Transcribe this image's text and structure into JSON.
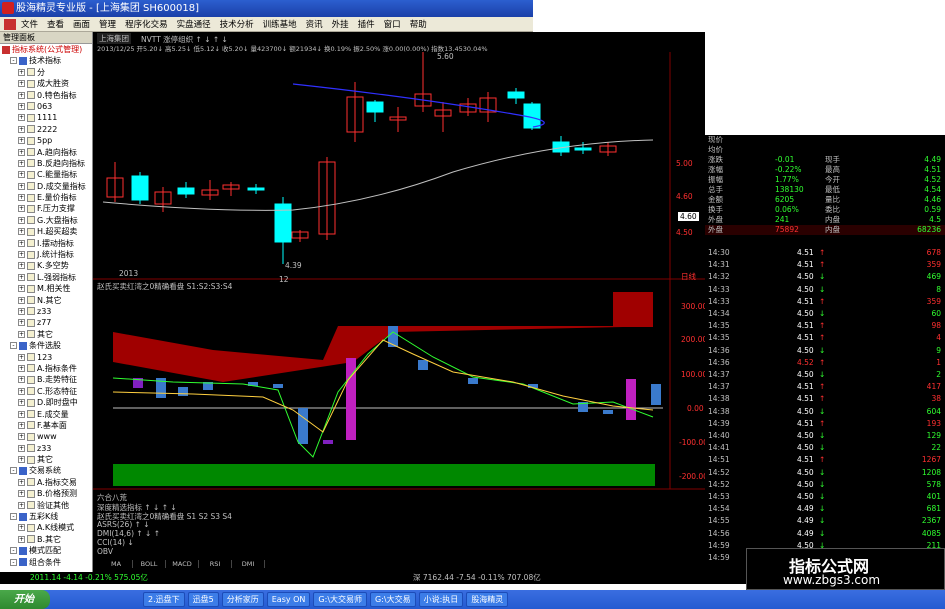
{
  "window": {
    "title": "股海精灵专业版 - [上海集团 SH600018]"
  },
  "menu": [
    "文件",
    "查看",
    "画面",
    "管理",
    "程序化交易",
    "实盘通径",
    "技术分析",
    "训练基地",
    "资讯",
    "外挂",
    "插件",
    "窗口",
    "帮助"
  ],
  "panel": {
    "header": "管理面板",
    "items": [
      {
        "indent": 0,
        "type": "head",
        "label": "指标系统(公式管理)"
      },
      {
        "indent": 1,
        "type": "box",
        "label": "技术指标"
      },
      {
        "indent": 2,
        "type": "leaf",
        "label": "分"
      },
      {
        "indent": 2,
        "type": "leaf",
        "label": "成大胜资"
      },
      {
        "indent": 2,
        "type": "leaf",
        "label": "0.特色指标"
      },
      {
        "indent": 2,
        "type": "leaf",
        "label": "063"
      },
      {
        "indent": 2,
        "type": "leaf",
        "label": "1111"
      },
      {
        "indent": 2,
        "type": "leaf",
        "label": "2222"
      },
      {
        "indent": 2,
        "type": "leaf",
        "label": "5pp"
      },
      {
        "indent": 2,
        "type": "leaf",
        "label": "A.趋向指标"
      },
      {
        "indent": 2,
        "type": "leaf",
        "label": "B.反趋向指标"
      },
      {
        "indent": 2,
        "type": "leaf",
        "label": "C.能量指标"
      },
      {
        "indent": 2,
        "type": "leaf",
        "label": "D.成交量指标"
      },
      {
        "indent": 2,
        "type": "leaf",
        "label": "E.量价指标"
      },
      {
        "indent": 2,
        "type": "leaf",
        "label": "F.压力支撑"
      },
      {
        "indent": 2,
        "type": "leaf",
        "label": "G.大盘指标"
      },
      {
        "indent": 2,
        "type": "leaf",
        "label": "H.超买超卖"
      },
      {
        "indent": 2,
        "type": "leaf",
        "label": "I.摆动指标"
      },
      {
        "indent": 2,
        "type": "leaf",
        "label": "J.统计指标"
      },
      {
        "indent": 2,
        "type": "leaf",
        "label": "K.多空势"
      },
      {
        "indent": 2,
        "type": "leaf",
        "label": "L.强弱指标"
      },
      {
        "indent": 2,
        "type": "leaf",
        "label": "M.相关性"
      },
      {
        "indent": 2,
        "type": "leaf",
        "label": "N.其它"
      },
      {
        "indent": 2,
        "type": "leaf",
        "label": "z33"
      },
      {
        "indent": 2,
        "type": "leaf",
        "label": "z77"
      },
      {
        "indent": 2,
        "type": "leaf",
        "label": "其它"
      },
      {
        "indent": 1,
        "type": "box",
        "label": "条件选股"
      },
      {
        "indent": 2,
        "type": "leaf",
        "label": "123"
      },
      {
        "indent": 2,
        "type": "leaf",
        "label": "A.指标条件"
      },
      {
        "indent": 2,
        "type": "leaf",
        "label": "B.走势特征"
      },
      {
        "indent": 2,
        "type": "leaf",
        "label": "C.形态特征"
      },
      {
        "indent": 2,
        "type": "leaf",
        "label": "D.即时盘中"
      },
      {
        "indent": 2,
        "type": "leaf",
        "label": "E.成交量"
      },
      {
        "indent": 2,
        "type": "leaf",
        "label": "F.基本面"
      },
      {
        "indent": 2,
        "type": "leaf",
        "label": "www"
      },
      {
        "indent": 2,
        "type": "leaf",
        "label": "z33"
      },
      {
        "indent": 2,
        "type": "leaf",
        "label": "其它"
      },
      {
        "indent": 1,
        "type": "box",
        "label": "交易系统"
      },
      {
        "indent": 2,
        "type": "leaf",
        "label": "A.指标交易"
      },
      {
        "indent": 2,
        "type": "leaf",
        "label": "B.价格预测"
      },
      {
        "indent": 2,
        "type": "leaf",
        "label": "验证其他"
      },
      {
        "indent": 1,
        "type": "box",
        "label": "五彩K线"
      },
      {
        "indent": 2,
        "type": "leaf",
        "label": "A.K线模式"
      },
      {
        "indent": 2,
        "type": "leaf",
        "label": "B.其它"
      },
      {
        "indent": 1,
        "type": "box",
        "label": "模式匹配"
      },
      {
        "indent": 1,
        "type": "box",
        "label": "组合条件"
      }
    ]
  },
  "chart": {
    "stock_name": "上海集团",
    "top_line": "NVTT  涨停组织  ↑ ↓ ↑ ↓",
    "info_line": "2013/12/25  开5.20↓  高5.25↓  低5.12↓  收5.20↓  量423700↓  额21934↓  换0.19%  振2.50%  涨0.00(0.00%)  指数13.4530.04%",
    "year_label": "2013",
    "month_label": "12",
    "period_label": "日线",
    "high_label": "5.60",
    "low_label": "4.39",
    "price_labels": [
      "5.00",
      "4.60",
      "4.50"
    ],
    "price_marker": "4.60",
    "ind1_title": "赵氏买卖红湾之0精确看盘  S1:S2:S3:S4",
    "ind1_labels": [
      "300.00",
      "200.00",
      "100.00",
      "0.00",
      "-100.00",
      "-200.00"
    ],
    "ind2_title": "六合八荒",
    "ind2_lines": [
      "深度精选指标  ↑ ↓ ↑ ↓",
      "赵氏买卖红湾之0精确看盘  S1 S2 S3 S4",
      "ASRS(26)  ↑ ↓",
      "DMI(14,6)  ↑ ↓ ↑",
      "CCI(14)  ↓",
      "OBV"
    ],
    "ind_tabs": [
      "MA",
      "BOLL",
      "MACD",
      "RSI",
      "DMI"
    ]
  },
  "quote": {
    "top_rows": [
      {
        "label": "现价",
        "val": ""
      },
      {
        "label": "均价",
        "val": ""
      },
      {
        "label": "涨跌",
        "val": "-0.01",
        "label2": "现手",
        "val2": "4.49"
      },
      {
        "label": "涨幅",
        "val": "-0.22%",
        "label2": "最高",
        "val2": "4.51"
      },
      {
        "label": "振幅",
        "val": "1.77%",
        "label2": "今开",
        "val2": "4.52"
      },
      {
        "label": "总手",
        "val": "138130",
        "label2": "最低",
        "val2": "4.54"
      },
      {
        "label": "金额",
        "val": "6205",
        "label2": "量比",
        "val2": "4.46"
      },
      {
        "label": "换手",
        "val": "0.06%",
        "label2": "委比",
        "val2": "0.59"
      },
      {
        "label": "外盘",
        "val": "241",
        "label2": "内盘",
        "val2": "4.5"
      },
      {
        "label": "外盘",
        "val": "75892",
        "label2": "内盘",
        "val2": "68236"
      }
    ],
    "ticks": [
      {
        "time": "14:30",
        "price": "4.51",
        "arrow": "↑",
        "vol": "678"
      },
      {
        "time": "14:31",
        "price": "4.51",
        "arrow": "↑",
        "vol": "359"
      },
      {
        "time": "14:32",
        "price": "4.50",
        "arrow": "↓",
        "vol": "469"
      },
      {
        "time": "14:33",
        "price": "4.50",
        "arrow": "↓",
        "vol": "8"
      },
      {
        "time": "14:33",
        "price": "4.51",
        "arrow": "↑",
        "vol": "359"
      },
      {
        "time": "14:34",
        "price": "4.50",
        "arrow": "↓",
        "vol": "60"
      },
      {
        "time": "14:35",
        "price": "4.51",
        "arrow": "↑",
        "vol": "98"
      },
      {
        "time": "14:35",
        "price": "4.51",
        "arrow": "↑",
        "vol": "4"
      },
      {
        "time": "14:36",
        "price": "4.50",
        "arrow": "↓",
        "vol": "9"
      },
      {
        "time": "14:36",
        "price": "4.52",
        "arrow": "↑",
        "vol": "1"
      },
      {
        "time": "14:37",
        "price": "4.50",
        "arrow": "↓",
        "vol": "2"
      },
      {
        "time": "14:37",
        "price": "4.51",
        "arrow": "↑",
        "vol": "417"
      },
      {
        "time": "14:38",
        "price": "4.51",
        "arrow": "↑",
        "vol": "38"
      },
      {
        "time": "14:38",
        "price": "4.50",
        "arrow": "↓",
        "vol": "604"
      },
      {
        "time": "14:39",
        "price": "4.51",
        "arrow": "↑",
        "vol": "193"
      },
      {
        "time": "14:40",
        "price": "4.50",
        "arrow": "↓",
        "vol": "129"
      },
      {
        "time": "14:41",
        "price": "4.50",
        "arrow": "↓",
        "vol": "22"
      },
      {
        "time": "14:51",
        "price": "4.51",
        "arrow": "↑",
        "vol": "1267"
      },
      {
        "time": "14:52",
        "price": "4.50",
        "arrow": "↓",
        "vol": "1208"
      },
      {
        "time": "14:52",
        "price": "4.50",
        "arrow": "↓",
        "vol": "578"
      },
      {
        "time": "14:53",
        "price": "4.50",
        "arrow": "↓",
        "vol": "401"
      },
      {
        "time": "14:54",
        "price": "4.49",
        "arrow": "↓",
        "vol": "681"
      },
      {
        "time": "14:55",
        "price": "4.49",
        "arrow": "↓",
        "vol": "2367"
      },
      {
        "time": "14:56",
        "price": "4.49",
        "arrow": "↓",
        "vol": "4085"
      },
      {
        "time": "14:59",
        "price": "4.50",
        "arrow": "↓",
        "vol": "211"
      },
      {
        "time": "14:59",
        "price": "",
        "arrow": "",
        "vol": ""
      }
    ]
  },
  "status": {
    "left": "2011.14  -4.14  -0.21%  575.05亿",
    "right": "深  7162.44  -7.54  -0.11%  707.08亿"
  },
  "taskbar": {
    "start": "开始",
    "items": [
      "2.迅盘下",
      "迅盘5",
      "分析家历",
      "Easy ON",
      "G:\\大交易师",
      "G:\\大交易",
      "小说:执日",
      "股海精灵"
    ]
  },
  "watermark": {
    "line1": "指标公式网",
    "line2": "www.zbgs3.com"
  },
  "colors": {
    "up": "#ff3030",
    "down": "#00ffff",
    "green": "#30ff30",
    "yellow": "#ffff30",
    "darkred": "#a00000",
    "band_green": "#008800"
  }
}
